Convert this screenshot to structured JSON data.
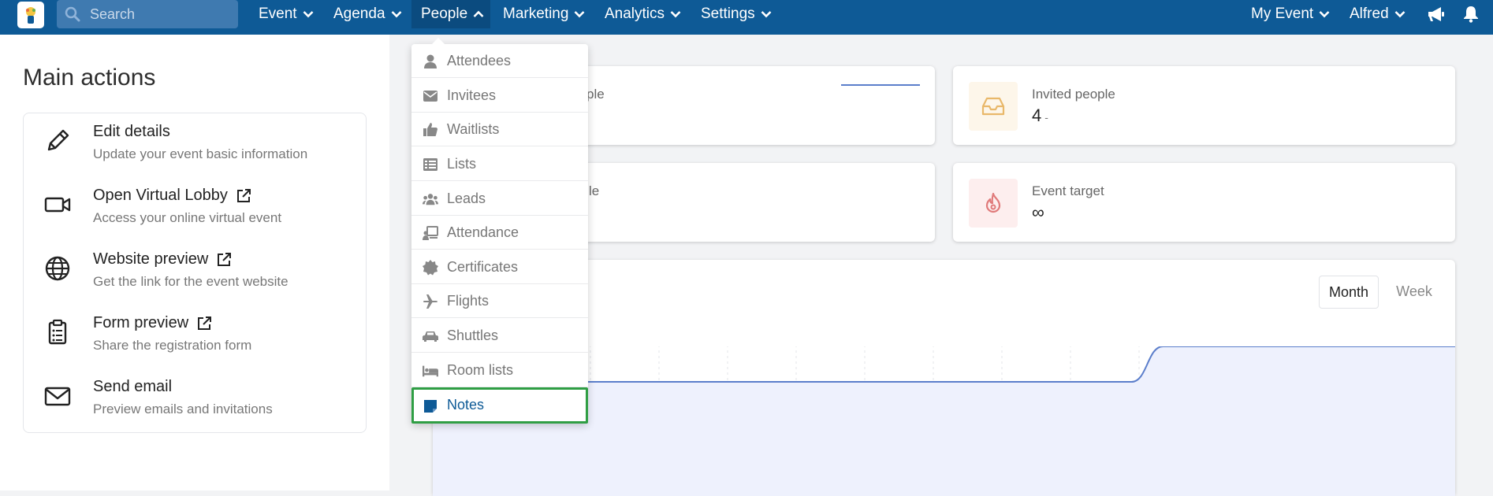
{
  "search": {
    "placeholder": "Search"
  },
  "nav": {
    "items": [
      {
        "label": "Event"
      },
      {
        "label": "Agenda"
      },
      {
        "label": "People"
      },
      {
        "label": "Marketing"
      },
      {
        "label": "Analytics"
      },
      {
        "label": "Settings"
      }
    ],
    "right": [
      {
        "label": "My Event"
      },
      {
        "label": "Alfred"
      }
    ]
  },
  "main_actions": {
    "title": "Main actions",
    "items": [
      {
        "title": "Edit details",
        "desc": "Update your event basic information",
        "icon": "pencil-icon"
      },
      {
        "title": "Open Virtual Lobby",
        "desc": "Access your online virtual event",
        "icon": "video-camera-icon"
      },
      {
        "title": "Website preview",
        "desc": "Get the link for the event website",
        "icon": "globe-icon"
      },
      {
        "title": "Form preview",
        "desc": "Share the registration form",
        "icon": "clipboard-icon"
      },
      {
        "title": "Send email",
        "desc": "Preview emails and invitations",
        "icon": "envelope-icon"
      }
    ]
  },
  "stats": {
    "card1_partial": "ple",
    "card3_partial": "le",
    "invited": {
      "label": "Invited people",
      "value": "4",
      "dash": "-"
    },
    "target": {
      "label": "Event target",
      "value": "∞"
    }
  },
  "chart": {
    "toggle_month": "Month",
    "toggle_week": "Week"
  },
  "chart_data": {
    "type": "area",
    "series": [
      {
        "values": [
          0,
          0,
          0,
          0,
          0,
          0,
          0,
          0,
          0,
          0,
          1,
          1,
          1,
          1,
          1
        ]
      }
    ]
  },
  "dropdown": {
    "items": [
      {
        "label": "Attendees",
        "icon": "person-icon"
      },
      {
        "label": "Invitees",
        "icon": "envelope-icon"
      },
      {
        "label": "Waitlists",
        "icon": "thumbs-up-icon"
      },
      {
        "label": "Lists",
        "icon": "list-icon"
      },
      {
        "label": "Leads",
        "icon": "users-icon"
      },
      {
        "label": "Attendance",
        "icon": "attendance-icon"
      },
      {
        "label": "Certificates",
        "icon": "certificate-icon"
      },
      {
        "label": "Flights",
        "icon": "plane-icon"
      },
      {
        "label": "Shuttles",
        "icon": "car-icon"
      },
      {
        "label": "Room lists",
        "icon": "bed-icon"
      },
      {
        "label": "Notes",
        "icon": "note-icon"
      }
    ]
  },
  "colors": {
    "brand": "#0e5a96",
    "highlight": "#2f9e44",
    "chart_line": "#5b7ecb"
  }
}
